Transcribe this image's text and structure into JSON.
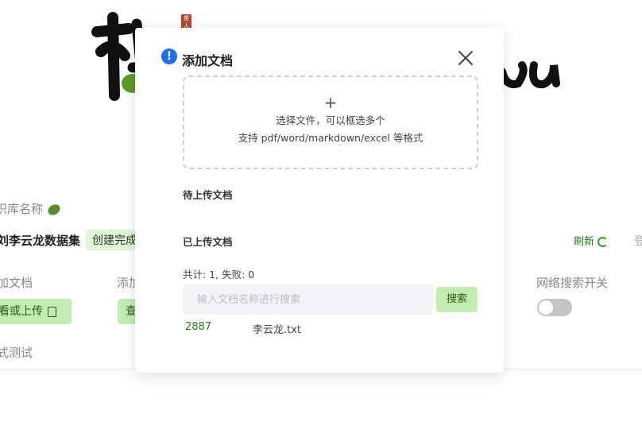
{
  "background": {
    "logo_tail": "ou",
    "logo_seal": "苗人",
    "kb_name_label": "识库名称",
    "dataset_name": "刘李云龙数据集",
    "status_badge": "创建完成",
    "refresh_label": "刷新",
    "login_partial": "登",
    "col1_label": "加文档",
    "col1_button": "看或上传",
    "col2_label": "添加",
    "col2_button": "查",
    "col3_label": "网络搜索开关",
    "col4_label": "式测试"
  },
  "modal": {
    "title": "添加文档",
    "info_icon": "!",
    "dropzone": {
      "plus": "+",
      "line1": "选择文件，可以框选多个",
      "line2": "支持 pdf/word/markdown/excel 等格式"
    },
    "pending_section": "待上传文档",
    "uploaded_section": "已上传文档",
    "stats": "共计: 1, 失败: 0",
    "search_placeholder": "输入文档名称进行搜索",
    "search_value": "",
    "search_button": "搜索",
    "files": [
      {
        "id": "2887",
        "name": "李云龙.txt"
      }
    ]
  },
  "colors": {
    "accent_green": "#c3ecb2",
    "info_blue": "#1e6ef0"
  }
}
